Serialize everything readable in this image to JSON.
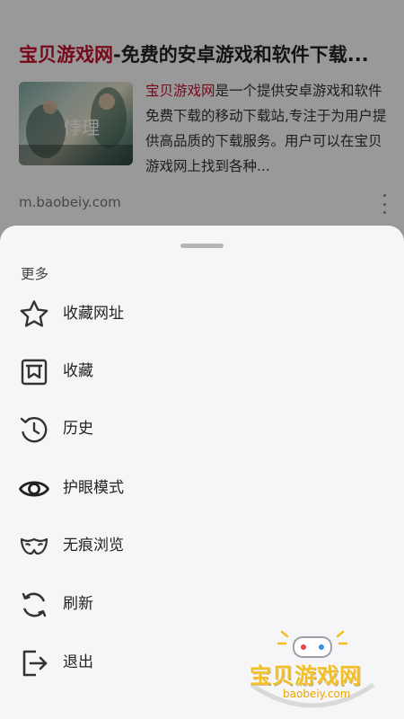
{
  "search_result": {
    "title_highlight": "宝贝游戏网",
    "title_rest": "-免费的安卓游戏和软件下载...",
    "desc_highlight": "宝贝游戏网",
    "desc_rest": "是一个提供安卓游戏和软件免费下载的移动下载站,专注于为用户提供高品质的下载服务。用户可以在宝贝游戏网上找到各种...",
    "url": "m.baobeiy.com",
    "thumb_text": "悖理"
  },
  "sheet": {
    "section_title": "更多",
    "items": [
      {
        "label": "收藏网址",
        "icon": "star-icon"
      },
      {
        "label": "收藏",
        "icon": "bookmark-icon"
      },
      {
        "label": "历史",
        "icon": "history-icon"
      },
      {
        "label": "护眼模式",
        "icon": "eye-icon"
      },
      {
        "label": "无痕浏览",
        "icon": "incognito-mask-icon"
      },
      {
        "label": "刷新",
        "icon": "refresh-icon"
      },
      {
        "label": "退出",
        "icon": "exit-icon"
      }
    ]
  },
  "watermark": {
    "name": "宝贝游戏网",
    "domain": "baobeiy.com"
  },
  "colors": {
    "highlight": "#c8102e",
    "sheet_bg": "#f6f6f8",
    "icon_stroke": "#333333",
    "watermark": "#f2c026"
  }
}
